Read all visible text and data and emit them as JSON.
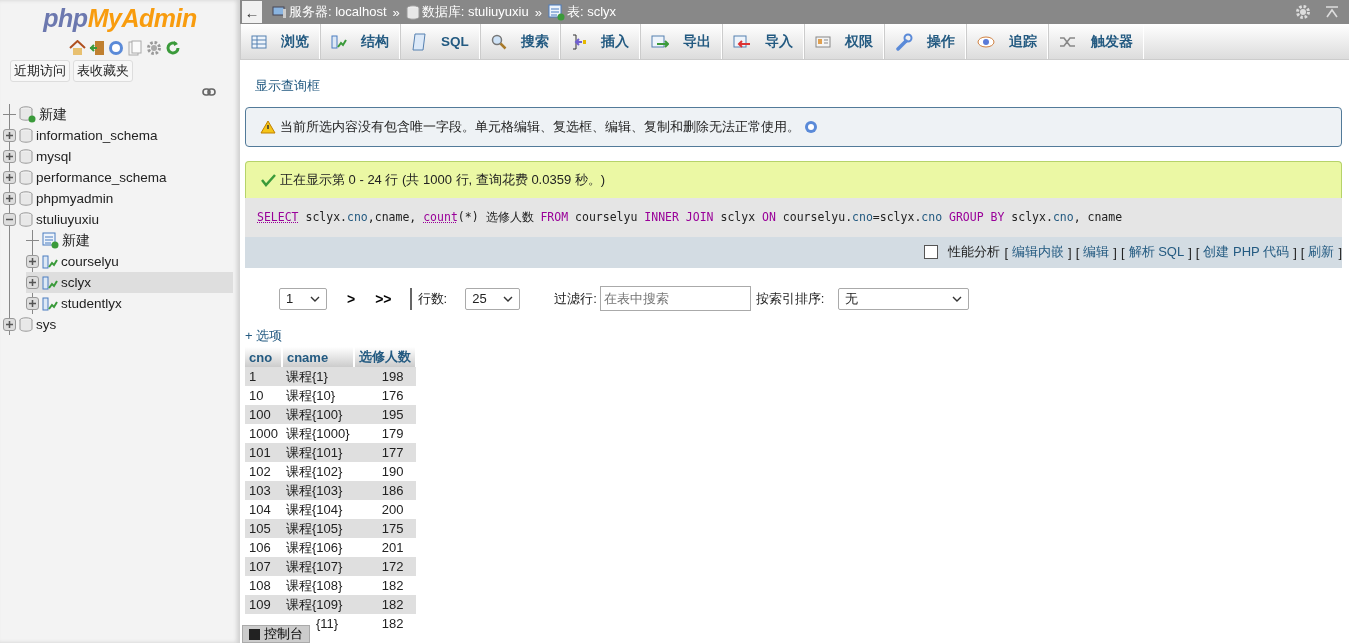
{
  "logo": {
    "part1": "php",
    "part2": "MyAdmin"
  },
  "sidebar": {
    "buttons": [
      "近期访问",
      "表收藏夹"
    ],
    "tree": [
      {
        "label": "新建",
        "kind": "new_db",
        "selected": false
      },
      {
        "label": "information_schema",
        "kind": "db",
        "expanded": false,
        "selected": false
      },
      {
        "label": "mysql",
        "kind": "db",
        "expanded": false,
        "selected": false
      },
      {
        "label": "performance_schema",
        "kind": "db",
        "expanded": false,
        "selected": false
      },
      {
        "label": "phpmyadmin",
        "kind": "db",
        "expanded": false,
        "selected": false
      },
      {
        "label": "stuliuyuxiu",
        "kind": "db",
        "expanded": true,
        "selected": false,
        "children": [
          {
            "label": "新建",
            "kind": "new_table",
            "selected": false
          },
          {
            "label": "courselyu",
            "kind": "table",
            "expanded": false,
            "selected": false
          },
          {
            "label": "sclyx",
            "kind": "table",
            "expanded": false,
            "selected": true
          },
          {
            "label": "studentlyx",
            "kind": "table",
            "expanded": false,
            "selected": false
          }
        ]
      },
      {
        "label": "sys",
        "kind": "db",
        "expanded": false,
        "selected": false
      }
    ]
  },
  "topbar": {
    "back": "←",
    "breadcrumb": [
      {
        "label": "服务器: localhost",
        "kind": "server",
        "separator": "»"
      },
      {
        "label": "数据库: stuliuyuxiu",
        "kind": "database",
        "separator": "»"
      },
      {
        "label": "表: sclyx",
        "kind": "table"
      }
    ]
  },
  "tabs": [
    {
      "label": "浏览",
      "kind": "browse",
      "selected": false
    },
    {
      "label": "结构",
      "kind": "structure",
      "selected": false
    },
    {
      "label": "SQL",
      "kind": "sql",
      "selected": false
    },
    {
      "label": "搜索",
      "kind": "search",
      "selected": false
    },
    {
      "label": "插入",
      "kind": "insert",
      "selected": false
    },
    {
      "label": "导出",
      "kind": "export",
      "selected": false
    },
    {
      "label": "导入",
      "kind": "import",
      "selected": false
    },
    {
      "label": "权限",
      "kind": "privileges",
      "selected": false
    },
    {
      "label": "操作",
      "kind": "operations",
      "selected": false
    },
    {
      "label": "追踪",
      "kind": "tracking",
      "selected": false
    },
    {
      "label": "触发器",
      "kind": "triggers",
      "selected": false
    }
  ],
  "show_query_link": "显示查询框",
  "notice": "当前所选内容没有包含唯一字段。单元格编辑、复选框、编辑、复制和删除无法正常使用。",
  "success": "正在显示第 0 - 24 行 (共 1000 行, 查询花费 0.0359 秒。)",
  "sql": [
    {
      "t": "SELECT",
      "kind": "doc_keyword"
    },
    {
      "t": " sclyx.",
      "kind": "plain"
    },
    {
      "t": "cno",
      "kind": "column"
    },
    {
      "t": ",cname, ",
      "kind": "plain"
    },
    {
      "t": "count",
      "kind": "doc_function"
    },
    {
      "t": "(*) 选修人数 ",
      "kind": "plain"
    },
    {
      "t": "FROM",
      "kind": "keyword"
    },
    {
      "t": " courselyu ",
      "kind": "plain"
    },
    {
      "t": "INNER JOIN",
      "kind": "keyword"
    },
    {
      "t": " sclyx ",
      "kind": "plain"
    },
    {
      "t": "ON",
      "kind": "keyword"
    },
    {
      "t": " courselyu.",
      "kind": "plain"
    },
    {
      "t": "cno",
      "kind": "column"
    },
    {
      "t": "=sclyx.",
      "kind": "plain"
    },
    {
      "t": "cno",
      "kind": "column"
    },
    {
      "t": " GROUP BY",
      "kind": "keyword"
    },
    {
      "t": " sclyx.",
      "kind": "plain"
    },
    {
      "t": "cno",
      "kind": "column"
    },
    {
      "t": ", cname",
      "kind": "plain"
    }
  ],
  "sql_actions": {
    "profiling": {
      "label": "性能分析",
      "checked": false
    },
    "links": [
      {
        "open": "[",
        "label": "编辑内嵌",
        "close": "]"
      },
      {
        "open": "[",
        "label": "编辑",
        "close": "]"
      },
      {
        "open": "[",
        "label": "解析 SQL",
        "close": "]"
      },
      {
        "open": "[",
        "label": "创建 PHP 代码",
        "close": "]"
      },
      {
        "open": "[",
        "label": "刷新",
        "close": "]"
      }
    ]
  },
  "pagination": {
    "page": "1",
    "nav": [
      ">",
      ">>"
    ],
    "rows_label": "行数:",
    "rows": "25",
    "filter_label": "过滤行:",
    "filter_placeholder": "在表中搜索",
    "sort_label": "按索引排序:",
    "sort": "无"
  },
  "options_link": "+ 选项",
  "table": {
    "columns": [
      "cno",
      "cname",
      "选修人数"
    ],
    "rows": [
      [
        "1",
        "课程{1}",
        "198"
      ],
      [
        "10",
        "课程{10}",
        "176"
      ],
      [
        "100",
        "课程{100}",
        "195"
      ],
      [
        "1000",
        "课程{1000}",
        "179"
      ],
      [
        "101",
        "课程{101}",
        "177"
      ],
      [
        "102",
        "课程{102}",
        "190"
      ],
      [
        "103",
        "课程{103}",
        "186"
      ],
      [
        "104",
        "课程{104}",
        "200"
      ],
      [
        "105",
        "课程{105}",
        "175"
      ],
      [
        "106",
        "课程{106}",
        "201"
      ],
      [
        "107",
        "课程{107}",
        "172"
      ],
      [
        "108",
        "课程{108}",
        "182"
      ],
      [
        "109",
        "课程{109}",
        "182"
      ],
      [
        null,
        "{11}",
        "182"
      ]
    ]
  },
  "console": "控制台"
}
